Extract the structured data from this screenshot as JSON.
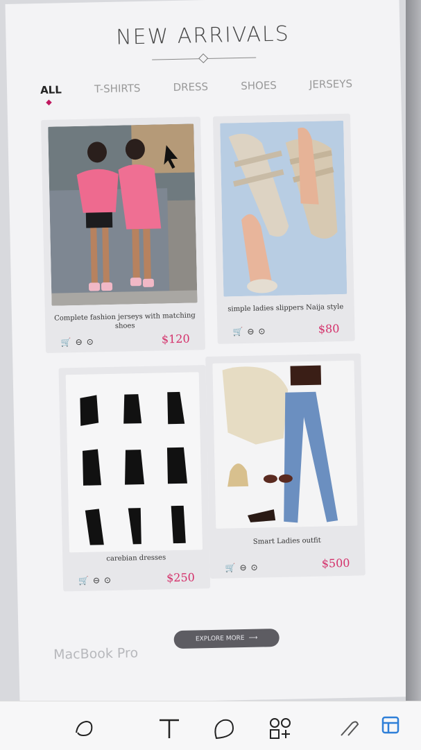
{
  "page": {
    "title": "NEW ARRIVALS",
    "tabs": [
      "ALL",
      "T-SHIRTS",
      "DRESS",
      "SHOES",
      "JERSEYS"
    ],
    "active_tab": "ALL"
  },
  "products": [
    {
      "name": "Complete fashion jerseys with matching shoes",
      "price": "$120"
    },
    {
      "name": "simple ladies slippers Naija style",
      "price": "$80"
    },
    {
      "name": "carebian dresses",
      "price": "$250"
    },
    {
      "name": "Smart Ladies outfit",
      "price": "$500"
    }
  ],
  "explore": {
    "label": "EXPLORE MORE"
  },
  "watermark": "MacBook Pro",
  "colors": {
    "accent": "#d4306a",
    "active_dot": "#c0185f",
    "button": "#5d5c62"
  },
  "icons": [
    "cart-icon",
    "minus-icon",
    "eye-icon",
    "arrow-right-icon",
    "lasso-icon",
    "text-icon",
    "shape-icon",
    "add-shape-icon",
    "pen-icon",
    "style-icon"
  ]
}
